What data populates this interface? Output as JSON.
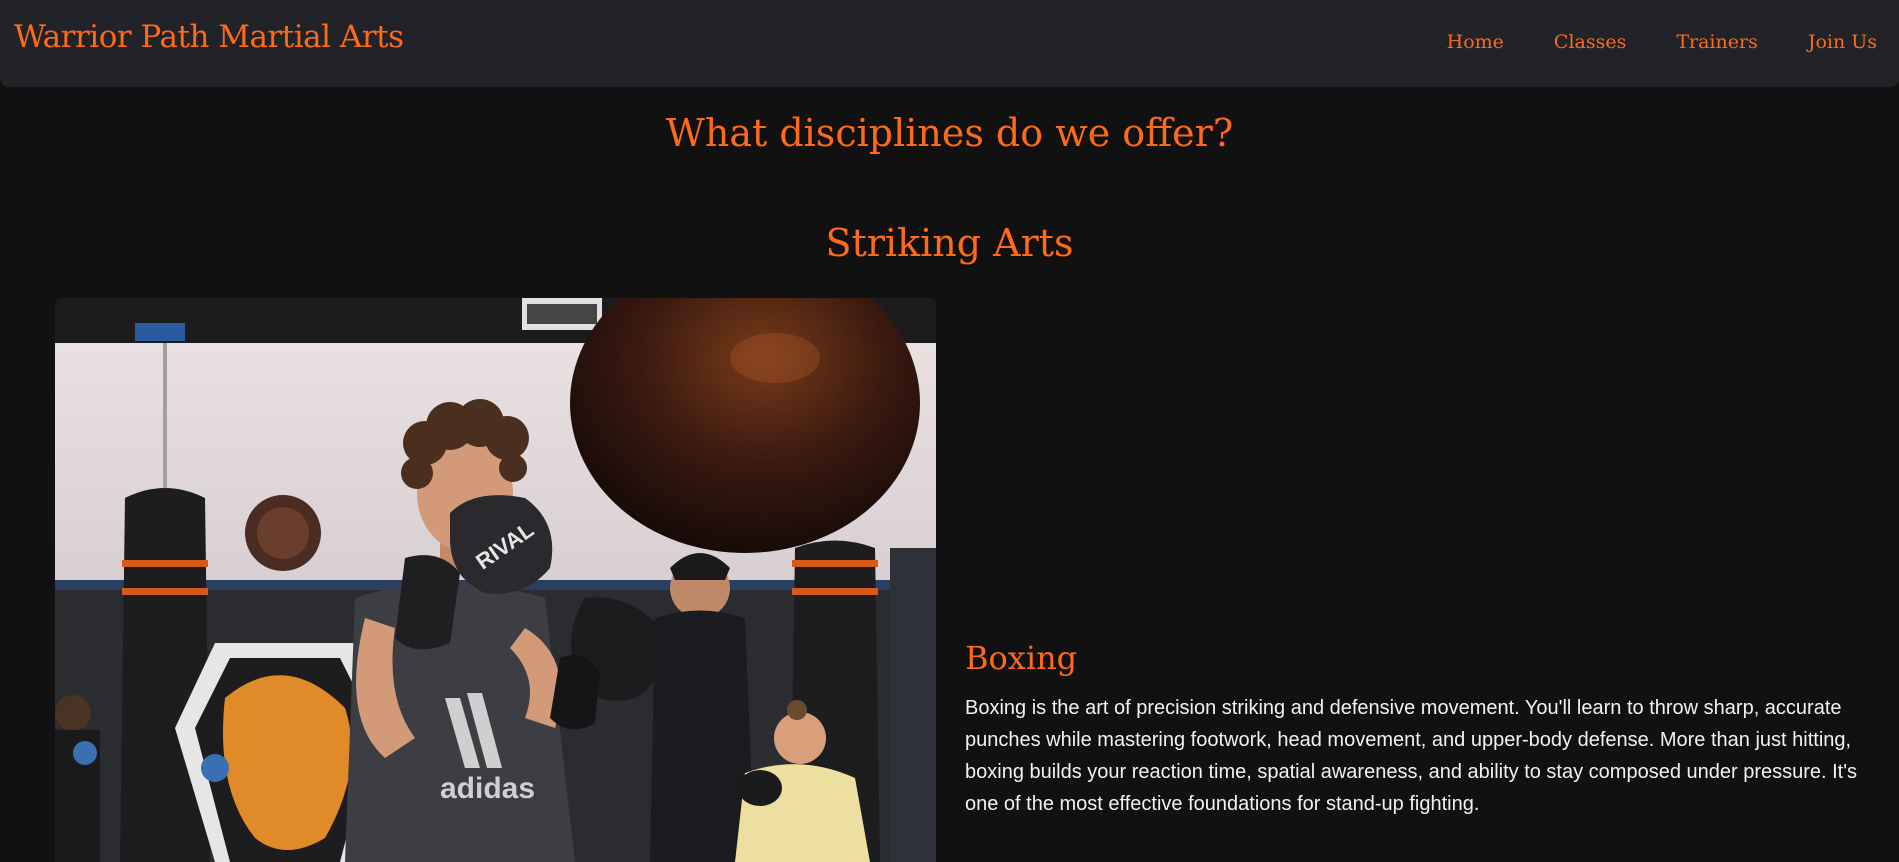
{
  "navbar": {
    "brand": "Warrior Path Martial Arts",
    "links": [
      "Home",
      "Classes",
      "Trainers",
      "Join Us"
    ]
  },
  "main": {
    "title": "What disciplines do we offer?",
    "category": "Striking Arts",
    "discipline": {
      "name": "Boxing",
      "description": "Boxing is the art of precision striking and defensive movement. You'll learn to throw sharp, accurate punches while mastering footwork, head movement, and upper-body defense. More than just hitting, boxing builds your reaction time, spatial awareness, and ability to stay composed under pressure. It's one of the most effective foundations for stand-up fighting."
    },
    "photo": {
      "glove_brand": "RIVAL",
      "shirt_brand": "adidas"
    }
  },
  "colors": {
    "accent": "#ff6a1a",
    "background": "#111111",
    "navbar_bg": "#212328",
    "text": "#f2f2f2"
  }
}
